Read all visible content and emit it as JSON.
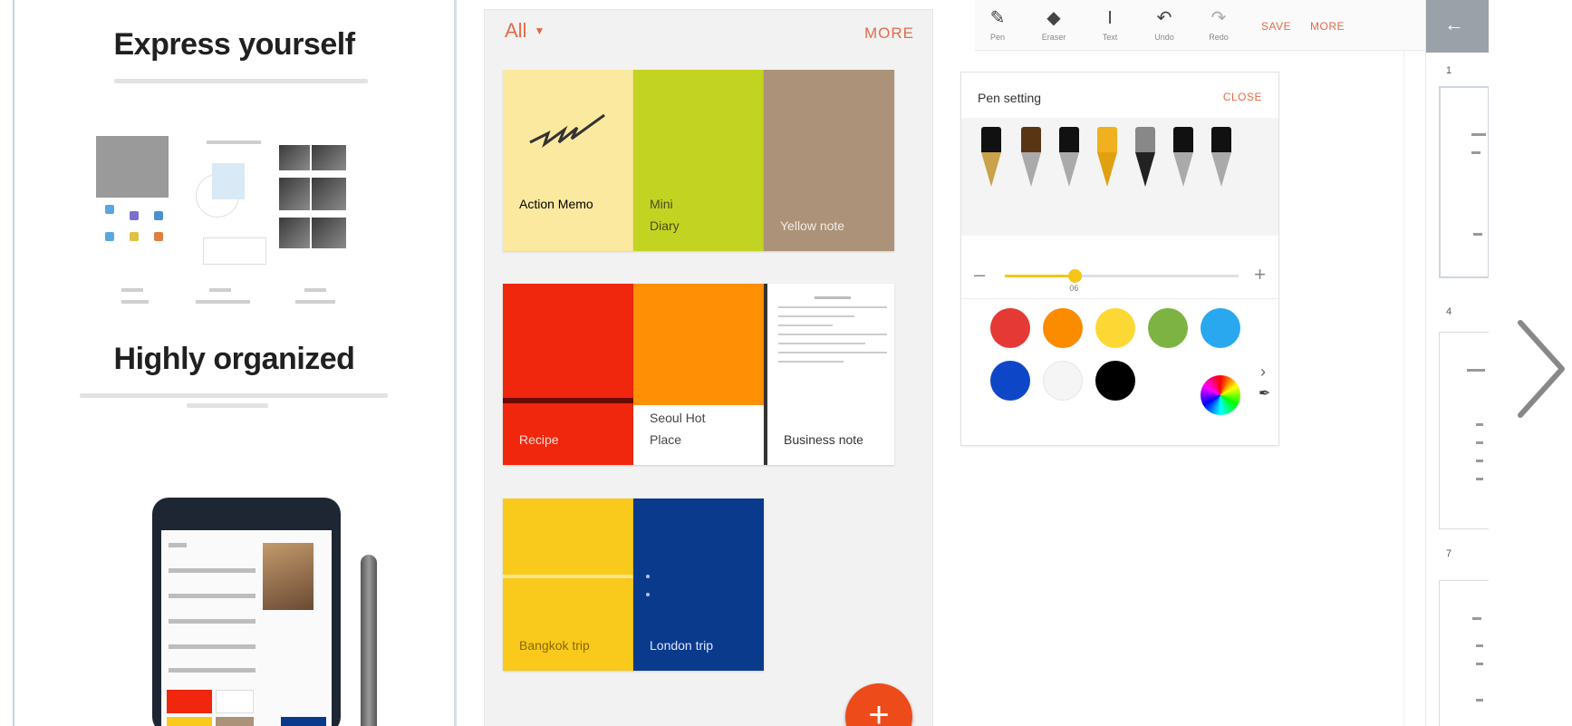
{
  "panel_marketing": {
    "heading1": "Express yourself",
    "heading2": "Highly organized"
  },
  "panel_notebooks": {
    "filter_label": "All",
    "more_label": "MORE",
    "notebooks": [
      {
        "title": "Action Memo",
        "subtitle": "",
        "color": "#fce9a0"
      },
      {
        "title": "Mini",
        "subtitle": "Diary",
        "color": "#c2d421"
      },
      {
        "title": "Yellow note",
        "subtitle": "",
        "color": "#ab9278"
      },
      {
        "title": "Recipe",
        "subtitle": "",
        "color": "#f0260d"
      },
      {
        "title": "Seoul Hot",
        "subtitle": "Place",
        "color": "#ff9006"
      },
      {
        "title": "Business note",
        "subtitle": "",
        "color": "#ffffff"
      },
      {
        "title": "Bangkok trip",
        "subtitle": "",
        "color": "#f9ca1c"
      },
      {
        "title": "London trip",
        "subtitle": "",
        "color": "#0a3a8c"
      }
    ],
    "add_label": "+"
  },
  "panel_editor": {
    "toolbar": {
      "tools": [
        "Pen",
        "Eraser",
        "Text",
        "Undo",
        "Redo"
      ],
      "save_label": "SAVE",
      "more_label": "MORE"
    },
    "pen_setting": {
      "title": "Pen setting",
      "close_label": "CLOSE",
      "size_value": "06",
      "size_fraction": 0.3,
      "colors": [
        "#e53935",
        "#fb8c00",
        "#fdd835",
        "#7cb342",
        "#29a8f0",
        "#0d47c8",
        "#f5f5f5",
        "#000000"
      ]
    }
  },
  "accent_color": "#e56a4b"
}
